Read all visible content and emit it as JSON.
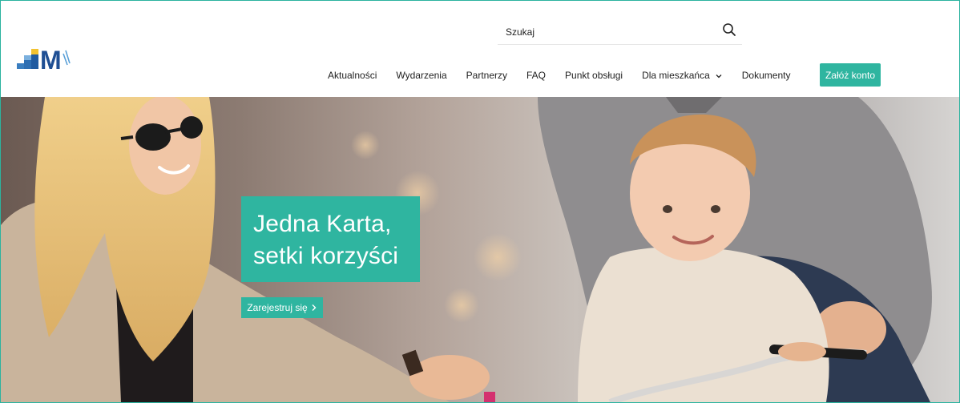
{
  "header": {
    "logo_text": "M",
    "search": {
      "placeholder": "Szukaj",
      "value": ""
    },
    "nav": [
      {
        "label": "Aktualności"
      },
      {
        "label": "Wydarzenia"
      },
      {
        "label": "Partnerzy"
      },
      {
        "label": "FAQ"
      },
      {
        "label": "Punkt obsługi"
      },
      {
        "label": "Dla mieszkańca",
        "icon": "chevron-down-icon"
      },
      {
        "label": "Dokumenty"
      }
    ],
    "cta_label": "Załóż konto"
  },
  "hero": {
    "headline_line1": "Jedna Karta,",
    "headline_line2": "setki korzyści",
    "register_label": "Zarejestruj się"
  },
  "colors": {
    "accent": "#2fb5a0",
    "frame": "#2bb39f"
  }
}
